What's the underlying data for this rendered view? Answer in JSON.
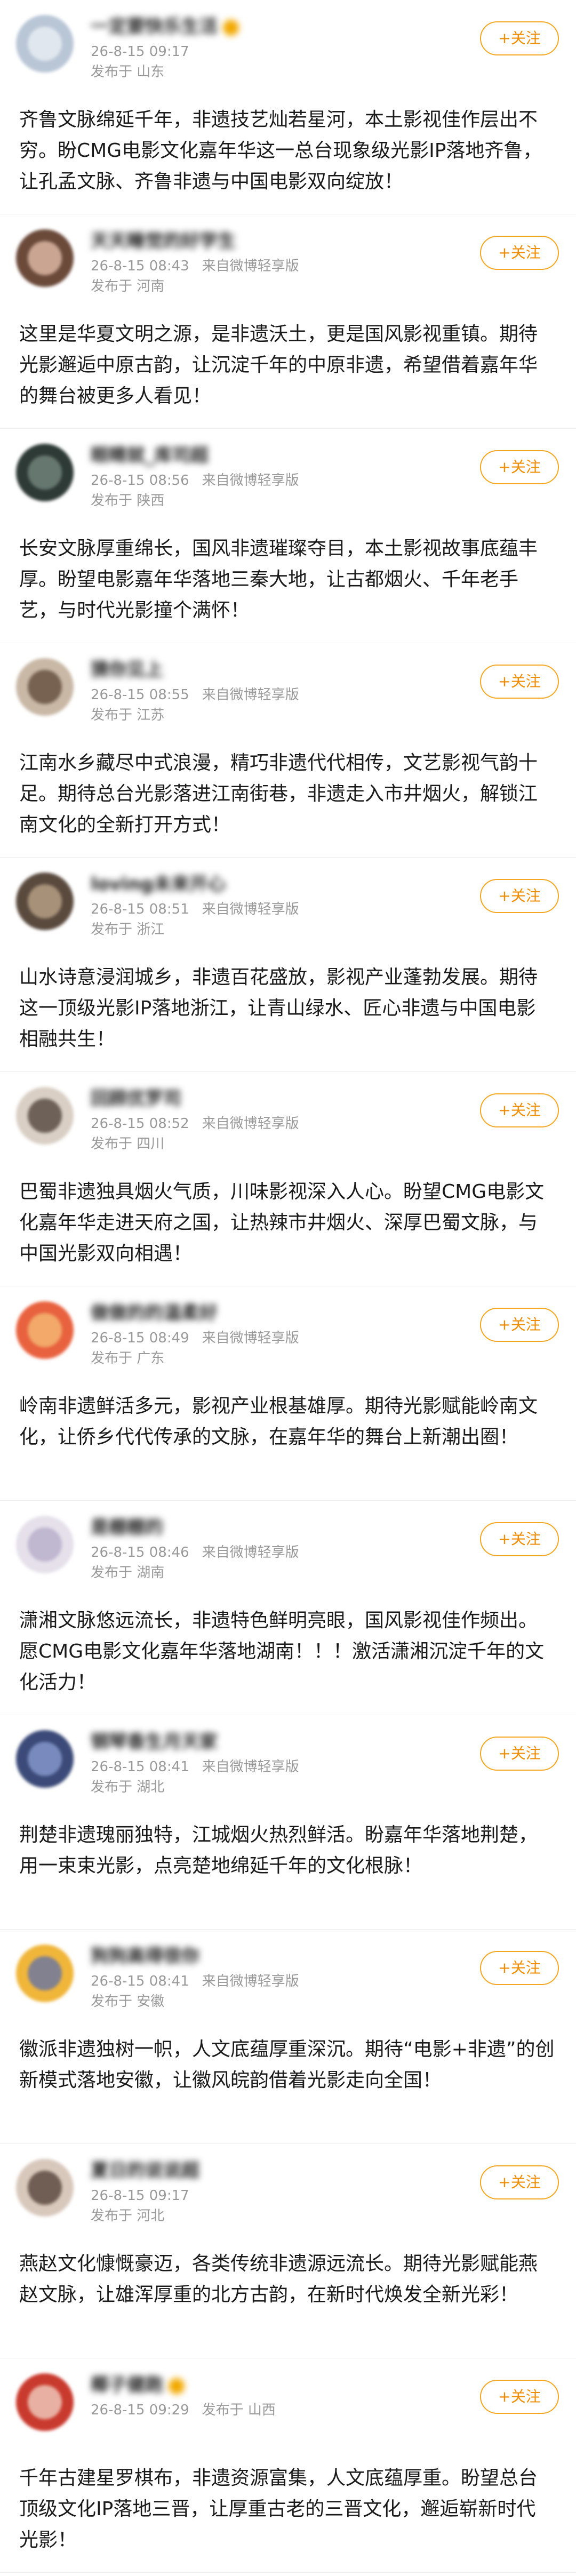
{
  "follow_label": "+关注",
  "posts": [
    {
      "name": "一定要快乐生活",
      "badge": true,
      "time": "26-8-15 09:17",
      "source": "",
      "location": "发布于 山东",
      "avatar_colors": [
        "#b9c6d6",
        "#eef1f5"
      ],
      "text": "齐鲁文脉绵延千年，非遗技艺灿若星河，本土影视佳作层出不穷。盼CMG电影文化嘉年华这一总台现象级光影IP落地齐鲁，让孔孟文脉、齐鲁非遗与中国电影双向绽放！"
    },
    {
      "name": "天天睡觉的好学生",
      "badge": false,
      "time": "26-8-15 08:43",
      "source": "来自微博轻享版",
      "location": "发布于 河南",
      "avatar_colors": [
        "#6b4a3a",
        "#e8c4b0"
      ],
      "text": "这里是华夏文明之源，是非遗沃土，更是国风影视重镇。期待光影邂逅中原古韵，让沉淀千年的中原非遗，希望借着嘉年华的舞台被更多人看见！"
    },
    {
      "name": "眼睛就_库司超",
      "badge": false,
      "time": "26-8-15 08:56",
      "source": "来自微博轻享版",
      "location": "发布于 陕西",
      "avatar_colors": [
        "#2e3a36",
        "#7a8c84"
      ],
      "text": "长安文脉厚重绵长，国风非遗璀璨夺目，本土影视故事底蕴丰厚。盼望电影嘉年华落地三秦大地，让古都烟火、千年老手艺，与时代光影撞个满怀！"
    },
    {
      "name": "猜你见上",
      "badge": false,
      "time": "26-8-15 08:55",
      "source": "来自微博轻享版",
      "location": "发布于 江苏",
      "avatar_colors": [
        "#c9b8a6",
        "#5b4636"
      ],
      "text": "江南水乡藏尽中式浪漫，精巧非遗代代相传，文艺影视气韵十足。期待总台光影落进江南街巷，非遗走入市井烟火，解锁江南文化的全新打开方式！"
    },
    {
      "name": "loving未来开心",
      "badge": false,
      "time": "26-8-15 08:51",
      "source": "来自微博轻享版",
      "location": "发布于 浙江",
      "avatar_colors": [
        "#5a4a3e",
        "#c2a98e"
      ],
      "text": "山水诗意浸润城乡，非遗百花盛放，影视产业蓬勃发展。期待这一顶级光影IP落地浙江，让青山绿水、匠心非遗与中国电影相融共生！"
    },
    {
      "name": "回顾优罗司",
      "badge": false,
      "time": "26-8-15 08:52",
      "source": "来自微博轻享版",
      "location": "发布于 四川",
      "avatar_colors": [
        "#d9cfc4",
        "#4a3c33"
      ],
      "text": "巴蜀非遗独具烟火气质，川味影视深入人心。盼望CMG电影文化嘉年华走进天府之国，让热辣市井烟火、深厚巴蜀文脉，与中国光影双向相遇！"
    },
    {
      "name": "做做的的温柔好",
      "badge": false,
      "time": "26-8-15 08:49",
      "source": "来自微博轻享版",
      "location": "发布于 广东",
      "avatar_colors": [
        "#e8623f",
        "#f5c27a"
      ],
      "text": "岭南非遗鲜活多元，影视产业根基雄厚。期待光影赋能岭南文化，让侨乡代代传承的文脉，在嘉年华的舞台上新潮出圈！"
    },
    {
      "name": "是棚棚的",
      "badge": false,
      "time": "26-8-15 08:46",
      "source": "来自微博轻享版",
      "location": "发布于 湖南",
      "avatar_colors": [
        "#e5e0ea",
        "#b3a9c7"
      ],
      "text": "潇湘文脉悠远流长，非遗特色鲜明亮眼，国风影视佳作频出。愿CMG电影文化嘉年华落地湖南！！！激活潇湘沉淀千年的文化活力！"
    },
    {
      "name": "钢琴香生月天家",
      "badge": false,
      "time": "26-8-15 08:41",
      "source": "来自微博轻享版",
      "location": "发布于 湖北",
      "avatar_colors": [
        "#3b4a78",
        "#8fa1d6"
      ],
      "text": "荆楚非遗瑰丽独特，江城烟火热烈鲜活。盼嘉年华落地荆楚，用一束束光影，点亮楚地绵延千年的文化根脉！"
    },
    {
      "name": "狗狗高得很你",
      "badge": false,
      "time": "26-8-15 08:41",
      "source": "来自微博轻享版",
      "location": "发布于 安徽",
      "avatar_colors": [
        "#f0b63a",
        "#5e6fae"
      ],
      "text": "徽派非遗独树一帜，人文底蕴厚重深沉。期待“电影+非遗”的创新模式落地安徽，让徽风皖韵借着光影走向全国！"
    },
    {
      "name": "夏日的说说超",
      "badge": false,
      "time": "26-8-15 09:17",
      "source": "",
      "location": "发布于 河北",
      "avatar_colors": [
        "#d8c8bc",
        "#4d3a30"
      ],
      "text": "燕赵文化慷慨豪迈，各类传统非遗源远流长。期待光影赋能燕赵文脉，让雄浑厚重的北方古韵，在新时代焕发全新光彩！"
    },
    {
      "name": "椰子健跑",
      "badge": true,
      "time": "26-8-15 09:29",
      "source": "发布于 山西",
      "location": "",
      "avatar_colors": [
        "#c93a2e",
        "#f2d8c9"
      ],
      "text": "千年古建星罗棋布，非遗资源富集，人文底蕴厚重。盼望总台顶级文化IP落地三晋，让厚重古老的三晋文化，邂逅崭新时代光影！"
    }
  ]
}
